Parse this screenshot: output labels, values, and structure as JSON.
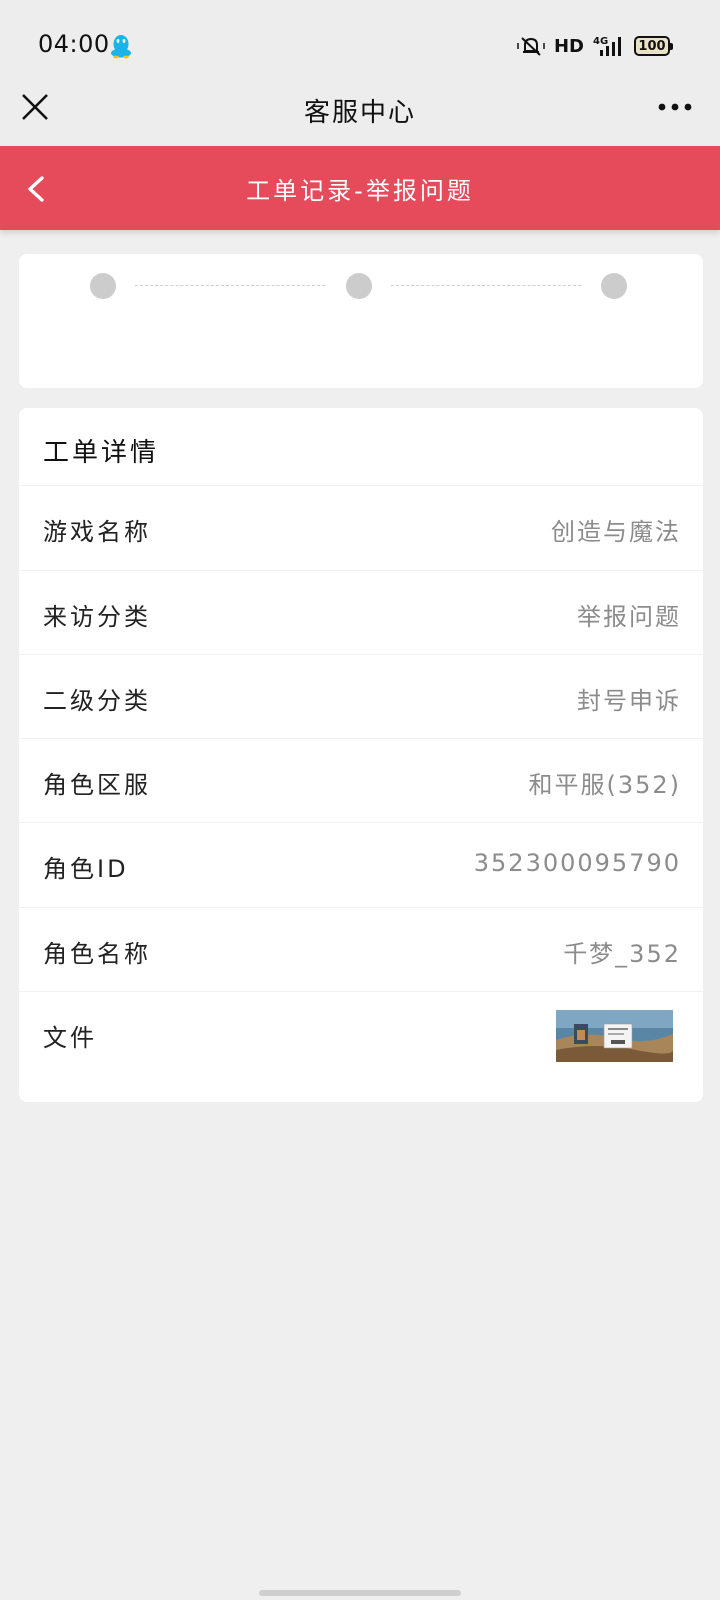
{
  "status_bar": {
    "time": "04:00",
    "network": "HD",
    "signal": "4G",
    "battery": "100"
  },
  "app_nav": {
    "title": "客服中心",
    "close_icon": "close-icon",
    "more_icon": "more-icon"
  },
  "header": {
    "title": "工单记录-举报问题",
    "back_icon": "chevron-left-icon",
    "color": "#e54b5a"
  },
  "progress": {
    "steps": 3,
    "dot_color": "#cccccc"
  },
  "detail": {
    "title": "工单详情",
    "rows": [
      {
        "label": "游戏名称",
        "value": "创造与魔法"
      },
      {
        "label": "来访分类",
        "value": "举报问题"
      },
      {
        "label": "二级分类",
        "value": "封号申诉"
      },
      {
        "label": "角色区服",
        "value": "和平服(352)"
      },
      {
        "label": "角色ID",
        "value": "352300095790"
      },
      {
        "label": "角色名称",
        "value": "千梦_352"
      }
    ],
    "file_label": "文件",
    "file_icon": "screenshot-thumbnail"
  }
}
